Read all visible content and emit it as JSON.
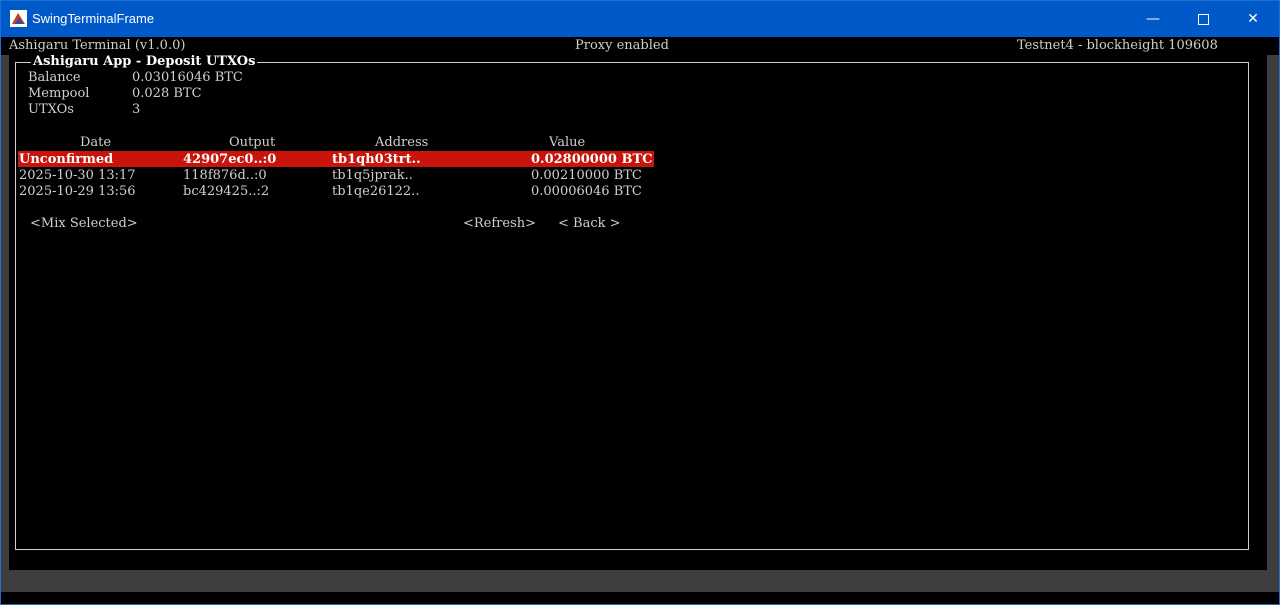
{
  "window": {
    "title": "SwingTerminalFrame"
  },
  "status": {
    "app": "Ashigaru Terminal (v1.0.0)",
    "proxy": "Proxy enabled",
    "network": "Testnet4 - blockheight 109608"
  },
  "panel": {
    "title": "Ashigaru App - Deposit UTXOs",
    "balance_label": "Balance",
    "balance_value": "0.03016046 BTC",
    "mempool_label": "Mempool",
    "mempool_value": "0.028 BTC",
    "utxos_label": "UTXOs",
    "utxos_value": "3"
  },
  "table": {
    "headers": [
      "Date",
      "Output",
      "Address",
      "Value"
    ],
    "rows": [
      {
        "date": "Unconfirmed",
        "output": "42907ec0..:0",
        "address": "tb1qh03trt..",
        "value": "0.02800000 BTC"
      },
      {
        "date": "2025-10-30 13:17",
        "output": "118f876d..:0",
        "address": "tb1q5jprak..",
        "value": "0.00210000 BTC"
      },
      {
        "date": "2025-10-29 13:56",
        "output": "bc429425..:2",
        "address": "tb1qe26122..",
        "value": "0.00006046 BTC"
      }
    ]
  },
  "buttons": {
    "mix": "<Mix Selected>",
    "refresh": "<Refresh>",
    "back": "< Back >"
  },
  "colors": {
    "titlebar": "#0059c9",
    "selection": "#c8140a",
    "text": "#cfcfcf"
  }
}
